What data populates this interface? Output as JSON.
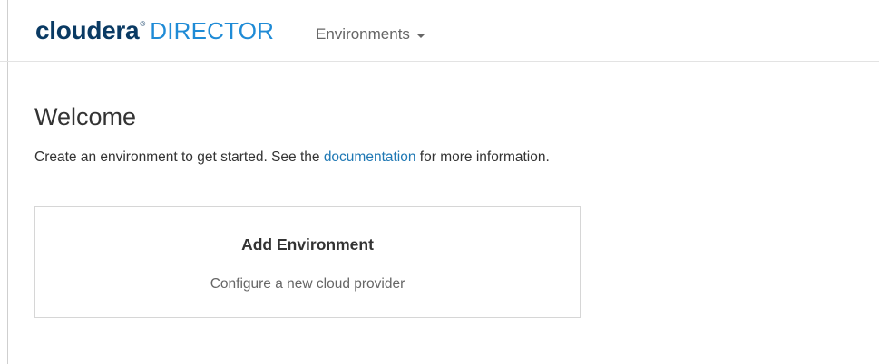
{
  "header": {
    "logo_brand": "cloudera",
    "logo_reg": "®",
    "logo_product": "DIRECTOR",
    "nav_menu_label": "Environments"
  },
  "main": {
    "title": "Welcome",
    "intro_before": "Create an environment to get started. See the ",
    "intro_link": "documentation",
    "intro_after": " for more information.",
    "card": {
      "title": "Add Environment",
      "subtitle": "Configure a new cloud provider"
    }
  },
  "colors": {
    "brand_dark": "#0a3a63",
    "brand_light": "#1f8bd6",
    "link": "#1f78b4",
    "text": "#333333",
    "muted": "#666666"
  },
  "icons": {
    "menu_caret": "caret-down-icon"
  }
}
